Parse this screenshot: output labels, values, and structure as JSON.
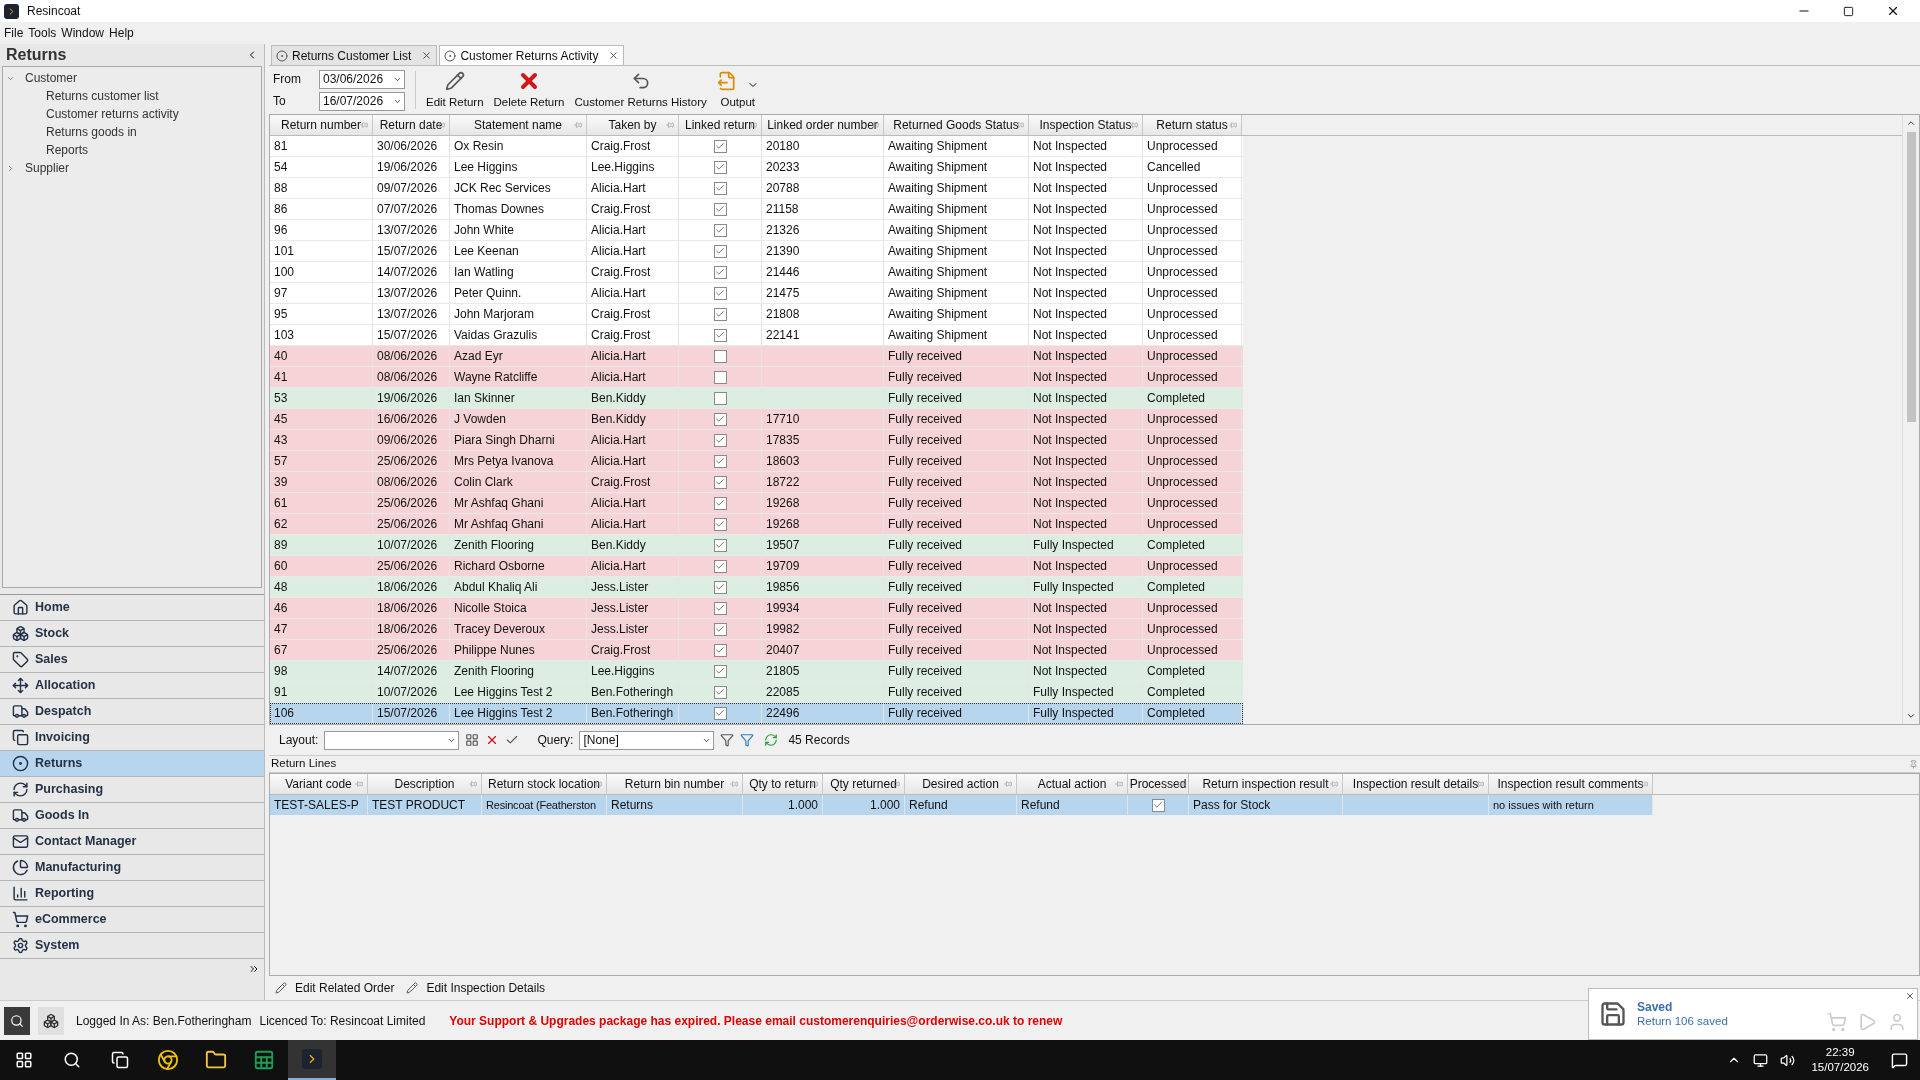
{
  "window": {
    "title": "Resincoat"
  },
  "menu": [
    "File",
    "Tools",
    "Window",
    "Help"
  ],
  "sidebar": {
    "title": "Returns",
    "tree": [
      {
        "label": "Customer",
        "expanded": true,
        "children": [
          {
            "label": "Returns customer list"
          },
          {
            "label": "Customer returns activity"
          },
          {
            "label": "Returns goods in"
          },
          {
            "label": "Reports"
          }
        ]
      },
      {
        "label": "Supplier",
        "expanded": false
      }
    ],
    "nav": [
      {
        "label": "Home",
        "selected": false
      },
      {
        "label": "Stock",
        "selected": false
      },
      {
        "label": "Sales",
        "selected": false
      },
      {
        "label": "Allocation",
        "selected": false
      },
      {
        "label": "Despatch",
        "selected": false
      },
      {
        "label": "Invoicing",
        "selected": false
      },
      {
        "label": "Returns",
        "selected": true
      },
      {
        "label": "Purchasing",
        "selected": false
      },
      {
        "label": "Goods In",
        "selected": false
      },
      {
        "label": "Contact Manager",
        "selected": false
      },
      {
        "label": "Manufacturing",
        "selected": false
      },
      {
        "label": "Reporting",
        "selected": false
      },
      {
        "label": "eCommerce",
        "selected": false
      },
      {
        "label": "System",
        "selected": false
      }
    ]
  },
  "tabs": [
    {
      "label": "Returns Customer List",
      "selected": false
    },
    {
      "label": "Customer Returns Activity",
      "selected": true
    }
  ],
  "toolbar": {
    "from_label": "From",
    "from": "03/06/2026",
    "to_label": "To",
    "to": "16/07/2026",
    "buttons": [
      {
        "label": "Edit Return",
        "kind": "edit"
      },
      {
        "label": "Delete Return",
        "kind": "delete"
      },
      {
        "label": "Customer Returns History",
        "kind": "history"
      },
      {
        "label": "Output",
        "kind": "output"
      }
    ]
  },
  "table": {
    "columns": [
      "Return number",
      "Return date",
      "Statement name",
      "Taken by",
      "Linked return",
      "Linked order number",
      "Returned Goods Status",
      "Inspection Status",
      "Return status"
    ],
    "rows": [
      {
        "number": "81",
        "date": "30/06/2026",
        "name": "Ox Resin",
        "taken_by": "Craig.Frost",
        "linked": true,
        "order": "20180",
        "goods": "Awaiting Shipment",
        "inspection": "Not Inspected",
        "status": "Unprocessed",
        "color": "#ffffff",
        "selected": false
      },
      {
        "number": "54",
        "date": "19/06/2026",
        "name": "Lee Higgins",
        "taken_by": "Lee.Higgins",
        "linked": true,
        "order": "20233",
        "goods": "Awaiting Shipment",
        "inspection": "Not Inspected",
        "status": "Cancelled",
        "color": "#ffffff",
        "selected": false
      },
      {
        "number": "88",
        "date": "09/07/2026",
        "name": "JCK Rec Services",
        "taken_by": "Alicia.Hart",
        "linked": true,
        "order": "20788",
        "goods": "Awaiting Shipment",
        "inspection": "Not Inspected",
        "status": "Unprocessed",
        "color": "#ffffff",
        "selected": false
      },
      {
        "number": "86",
        "date": "07/07/2026",
        "name": "Thomas Downes",
        "taken_by": "Craig.Frost",
        "linked": true,
        "order": "21158",
        "goods": "Awaiting Shipment",
        "inspection": "Not Inspected",
        "status": "Unprocessed",
        "color": "#ffffff",
        "selected": false
      },
      {
        "number": "96",
        "date": "13/07/2026",
        "name": "John White",
        "taken_by": "Alicia.Hart",
        "linked": true,
        "order": "21326",
        "goods": "Awaiting Shipment",
        "inspection": "Not Inspected",
        "status": "Unprocessed",
        "color": "#ffffff",
        "selected": false
      },
      {
        "number": "101",
        "date": "15/07/2026",
        "name": "Lee Keenan",
        "taken_by": "Alicia.Hart",
        "linked": true,
        "order": "21390",
        "goods": "Awaiting Shipment",
        "inspection": "Not Inspected",
        "status": "Unprocessed",
        "color": "#ffffff",
        "selected": false
      },
      {
        "number": "100",
        "date": "14/07/2026",
        "name": "Ian Watling",
        "taken_by": "Craig.Frost",
        "linked": true,
        "order": "21446",
        "goods": "Awaiting Shipment",
        "inspection": "Not Inspected",
        "status": "Unprocessed",
        "color": "#ffffff",
        "selected": false
      },
      {
        "number": "97",
        "date": "13/07/2026",
        "name": "Peter Quinn.",
        "taken_by": "Alicia.Hart",
        "linked": true,
        "order": "21475",
        "goods": "Awaiting Shipment",
        "inspection": "Not Inspected",
        "status": "Unprocessed",
        "color": "#ffffff",
        "selected": false
      },
      {
        "number": "95",
        "date": "13/07/2026",
        "name": "John Marjoram",
        "taken_by": "Craig.Frost",
        "linked": true,
        "order": "21808",
        "goods": "Awaiting Shipment",
        "inspection": "Not Inspected",
        "status": "Unprocessed",
        "color": "#ffffff",
        "selected": false
      },
      {
        "number": "103",
        "date": "15/07/2026",
        "name": "Vaidas Grazulis",
        "taken_by": "Craig.Frost",
        "linked": true,
        "order": "22141",
        "goods": "Awaiting Shipment",
        "inspection": "Not Inspected",
        "status": "Unprocessed",
        "color": "#ffffff",
        "selected": false
      },
      {
        "number": "40",
        "date": "08/06/2026",
        "name": "Azad Eyr",
        "taken_by": "Alicia.Hart",
        "linked": false,
        "goods": "Fully received",
        "inspection": "Not Inspected",
        "status": "Unprocessed",
        "color": "#f6d3d7",
        "selected": false
      },
      {
        "number": "41",
        "date": "08/06/2026",
        "name": "Wayne Ratcliffe",
        "taken_by": "Alicia.Hart",
        "linked": false,
        "goods": "Fully received",
        "inspection": "Not Inspected",
        "status": "Unprocessed",
        "color": "#f6d3d7",
        "selected": false
      },
      {
        "number": "53",
        "date": "19/06/2026",
        "name": "Ian Skinner",
        "taken_by": "Ben.Kiddy",
        "linked": false,
        "goods": "Fully received",
        "inspection": "Not Inspected",
        "status": "Completed",
        "color": "#dbeee1",
        "selected": false
      },
      {
        "number": "45",
        "date": "16/06/2026",
        "name": "J Vowden",
        "taken_by": "Ben.Kiddy",
        "linked": true,
        "order": "17710",
        "goods": "Fully received",
        "inspection": "Not Inspected",
        "status": "Unprocessed",
        "color": "#f6d3d7",
        "selected": false
      },
      {
        "number": "43",
        "date": "09/06/2026",
        "name": "Piara Singh Dharni",
        "taken_by": "Alicia.Hart",
        "linked": true,
        "order": "17835",
        "goods": "Fully received",
        "inspection": "Not Inspected",
        "status": "Unprocessed",
        "color": "#f6d3d7",
        "selected": false
      },
      {
        "number": "57",
        "date": "25/06/2026",
        "name": "Mrs Petya Ivanova",
        "taken_by": "Alicia.Hart",
        "linked": true,
        "order": "18603",
        "goods": "Fully received",
        "inspection": "Not Inspected",
        "status": "Unprocessed",
        "color": "#f6d3d7",
        "selected": false
      },
      {
        "number": "39",
        "date": "08/06/2026",
        "name": "Colin Clark",
        "taken_by": "Craig.Frost",
        "linked": true,
        "order": "18722",
        "goods": "Fully received",
        "inspection": "Not Inspected",
        "status": "Unprocessed",
        "color": "#f6d3d7",
        "selected": false
      },
      {
        "number": "61",
        "date": "25/06/2026",
        "name": "Mr Ashfaq Ghani",
        "taken_by": "Alicia.Hart",
        "linked": true,
        "order": "19268",
        "goods": "Fully received",
        "inspection": "Not Inspected",
        "status": "Unprocessed",
        "color": "#f6d3d7",
        "selected": false
      },
      {
        "number": "62",
        "date": "25/06/2026",
        "name": "Mr Ashfaq Ghani",
        "taken_by": "Alicia.Hart",
        "linked": true,
        "order": "19268",
        "goods": "Fully received",
        "inspection": "Not Inspected",
        "status": "Unprocessed",
        "color": "#f6d3d7",
        "selected": false
      },
      {
        "number": "89",
        "date": "10/07/2026",
        "name": "Zenith Flooring",
        "taken_by": "Ben.Kiddy",
        "linked": true,
        "order": "19507",
        "goods": "Fully received",
        "inspection": "Fully Inspected",
        "status": "Completed",
        "color": "#dbeee1",
        "selected": false
      },
      {
        "number": "60",
        "date": "25/06/2026",
        "name": "Richard Osborne",
        "taken_by": "Alicia.Hart",
        "linked": true,
        "order": "19709",
        "goods": "Fully received",
        "inspection": "Not Inspected",
        "status": "Unprocessed",
        "color": "#f6d3d7",
        "selected": false
      },
      {
        "number": "48",
        "date": "18/06/2026",
        "name": "Abdul Khaliq Ali",
        "taken_by": "Jess.Lister",
        "linked": true,
        "order": "19856",
        "goods": "Fully received",
        "inspection": "Fully Inspected",
        "status": "Completed",
        "color": "#dbeee1",
        "selected": false
      },
      {
        "number": "46",
        "date": "18/06/2026",
        "name": "Nicolle Stoica",
        "taken_by": "Jess.Lister",
        "linked": true,
        "order": "19934",
        "goods": "Fully received",
        "inspection": "Not Inspected",
        "status": "Unprocessed",
        "color": "#f6d3d7",
        "selected": false
      },
      {
        "number": "47",
        "date": "18/06/2026",
        "name": "Tracey Deveroux",
        "taken_by": "Jess.Lister",
        "linked": true,
        "order": "19982",
        "goods": "Fully received",
        "inspection": "Not Inspected",
        "status": "Unprocessed",
        "color": "#f6d3d7",
        "selected": false
      },
      {
        "number": "67",
        "date": "25/06/2026",
        "name": "Philippe Nunes",
        "taken_by": "Craig.Frost",
        "linked": true,
        "order": "20407",
        "goods": "Fully received",
        "inspection": "Not Inspected",
        "status": "Unprocessed",
        "color": "#f6d3d7",
        "selected": false
      },
      {
        "number": "98",
        "date": "14/07/2026",
        "name": "Zenith Flooring",
        "taken_by": "Lee.Higgins",
        "linked": true,
        "order": "21805",
        "goods": "Fully received",
        "inspection": "Not Inspected",
        "status": "Completed",
        "color": "#dbeee1",
        "selected": false
      },
      {
        "number": "91",
        "date": "10/07/2026",
        "name": "Lee Higgins Test 2",
        "taken_by": "Ben.Fotheringh",
        "linked": true,
        "order": "22085",
        "goods": "Fully received",
        "inspection": "Fully Inspected",
        "status": "Completed",
        "color": "#dbeee1",
        "selected": false
      },
      {
        "number": "106",
        "date": "15/07/2026",
        "name": "Lee Higgins Test 2",
        "taken_by": "Ben.Fotheringh",
        "linked": true,
        "order": "22496",
        "goods": "Fully received",
        "inspection": "Fully Inspected",
        "status": "Completed",
        "selected": true
      }
    ]
  },
  "layout_bar": {
    "layout_label": "Layout:",
    "query_label": "Query:",
    "query": "[None]",
    "records": "45 Records"
  },
  "return_lines": {
    "title": "Return Lines",
    "columns": [
      "Variant code",
      "Description",
      "Return stock location",
      "Return bin number",
      "Qty to return",
      "Qty returned",
      "Desired action",
      "Actual action",
      "Processed",
      "Return inspection result",
      "Inspection result details",
      "Inspection result comments"
    ],
    "rows": [
      {
        "variant": "TEST-SALES-P",
        "description": "TEST PRODUCT",
        "location": "Resincoat (Featherston",
        "bin": "Returns",
        "qty_to_return": "1.000",
        "qty_returned": "1.000",
        "desired": "Refund",
        "actual": "Refund",
        "processed": true,
        "result": "Pass for Stock",
        "comments": "no issues with return",
        "selected": true
      }
    ]
  },
  "actions": [
    "Edit Related Order",
    "Edit Inspection Details"
  ],
  "status_bar": {
    "logged_in": "Logged In As: Ben.Fotheringham",
    "licence": "Licenced To: Resincoat Limited",
    "message": "Your Support & Upgrades package has expired. Please email customerenquiries@orderwise.co.uk to renew"
  },
  "notification": {
    "title": "Saved",
    "text": "Return 106 saved"
  },
  "taskbar": {
    "time": "22:39",
    "date": "15/07/2026"
  }
}
